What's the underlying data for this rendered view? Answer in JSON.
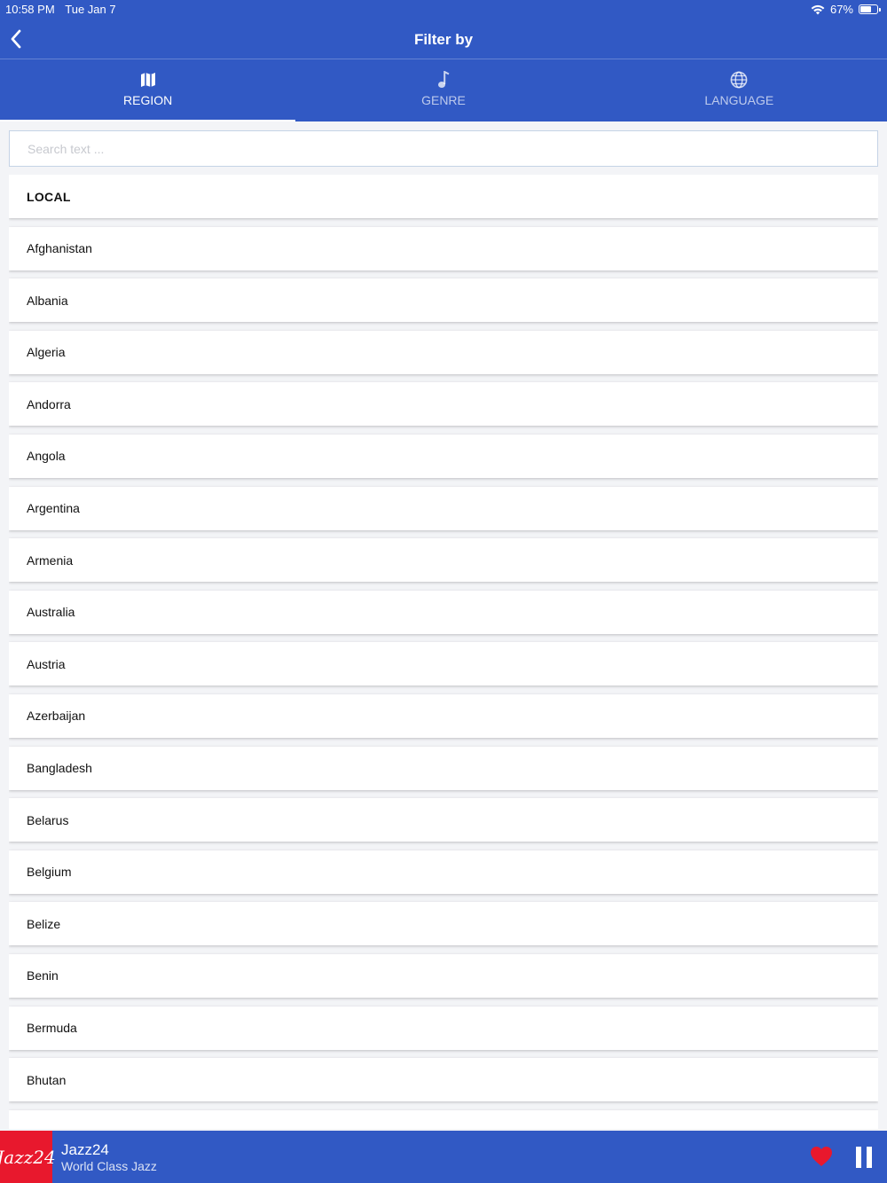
{
  "status_bar": {
    "time": "10:58 PM",
    "date": "Tue Jan 7",
    "battery": "67%",
    "battery_level": 0.67
  },
  "nav": {
    "title": "Filter by",
    "back_icon": "chevron-left-icon"
  },
  "tabs": [
    {
      "label": "REGION",
      "icon": "map-icon",
      "active": true
    },
    {
      "label": "GENRE",
      "icon": "music-note-icon",
      "active": false
    },
    {
      "label": "LANGUAGE",
      "icon": "globe-icon",
      "active": false
    }
  ],
  "search": {
    "placeholder": "Search text ...",
    "value": ""
  },
  "regions": [
    "LOCAL",
    "Afghanistan",
    "Albania",
    "Algeria",
    "Andorra",
    "Angola",
    "Argentina",
    "Armenia",
    "Australia",
    "Austria",
    "Azerbaijan",
    "Bangladesh",
    "Belarus",
    "Belgium",
    "Belize",
    "Benin",
    "Bermuda",
    "Bhutan",
    ""
  ],
  "player": {
    "art_text": "Jazz24",
    "station": "Jazz24",
    "subtitle": "World Class Jazz",
    "heart_color": "#e8182d"
  },
  "colors": {
    "accent": "#3159c4",
    "favorite": "#e8182d"
  }
}
